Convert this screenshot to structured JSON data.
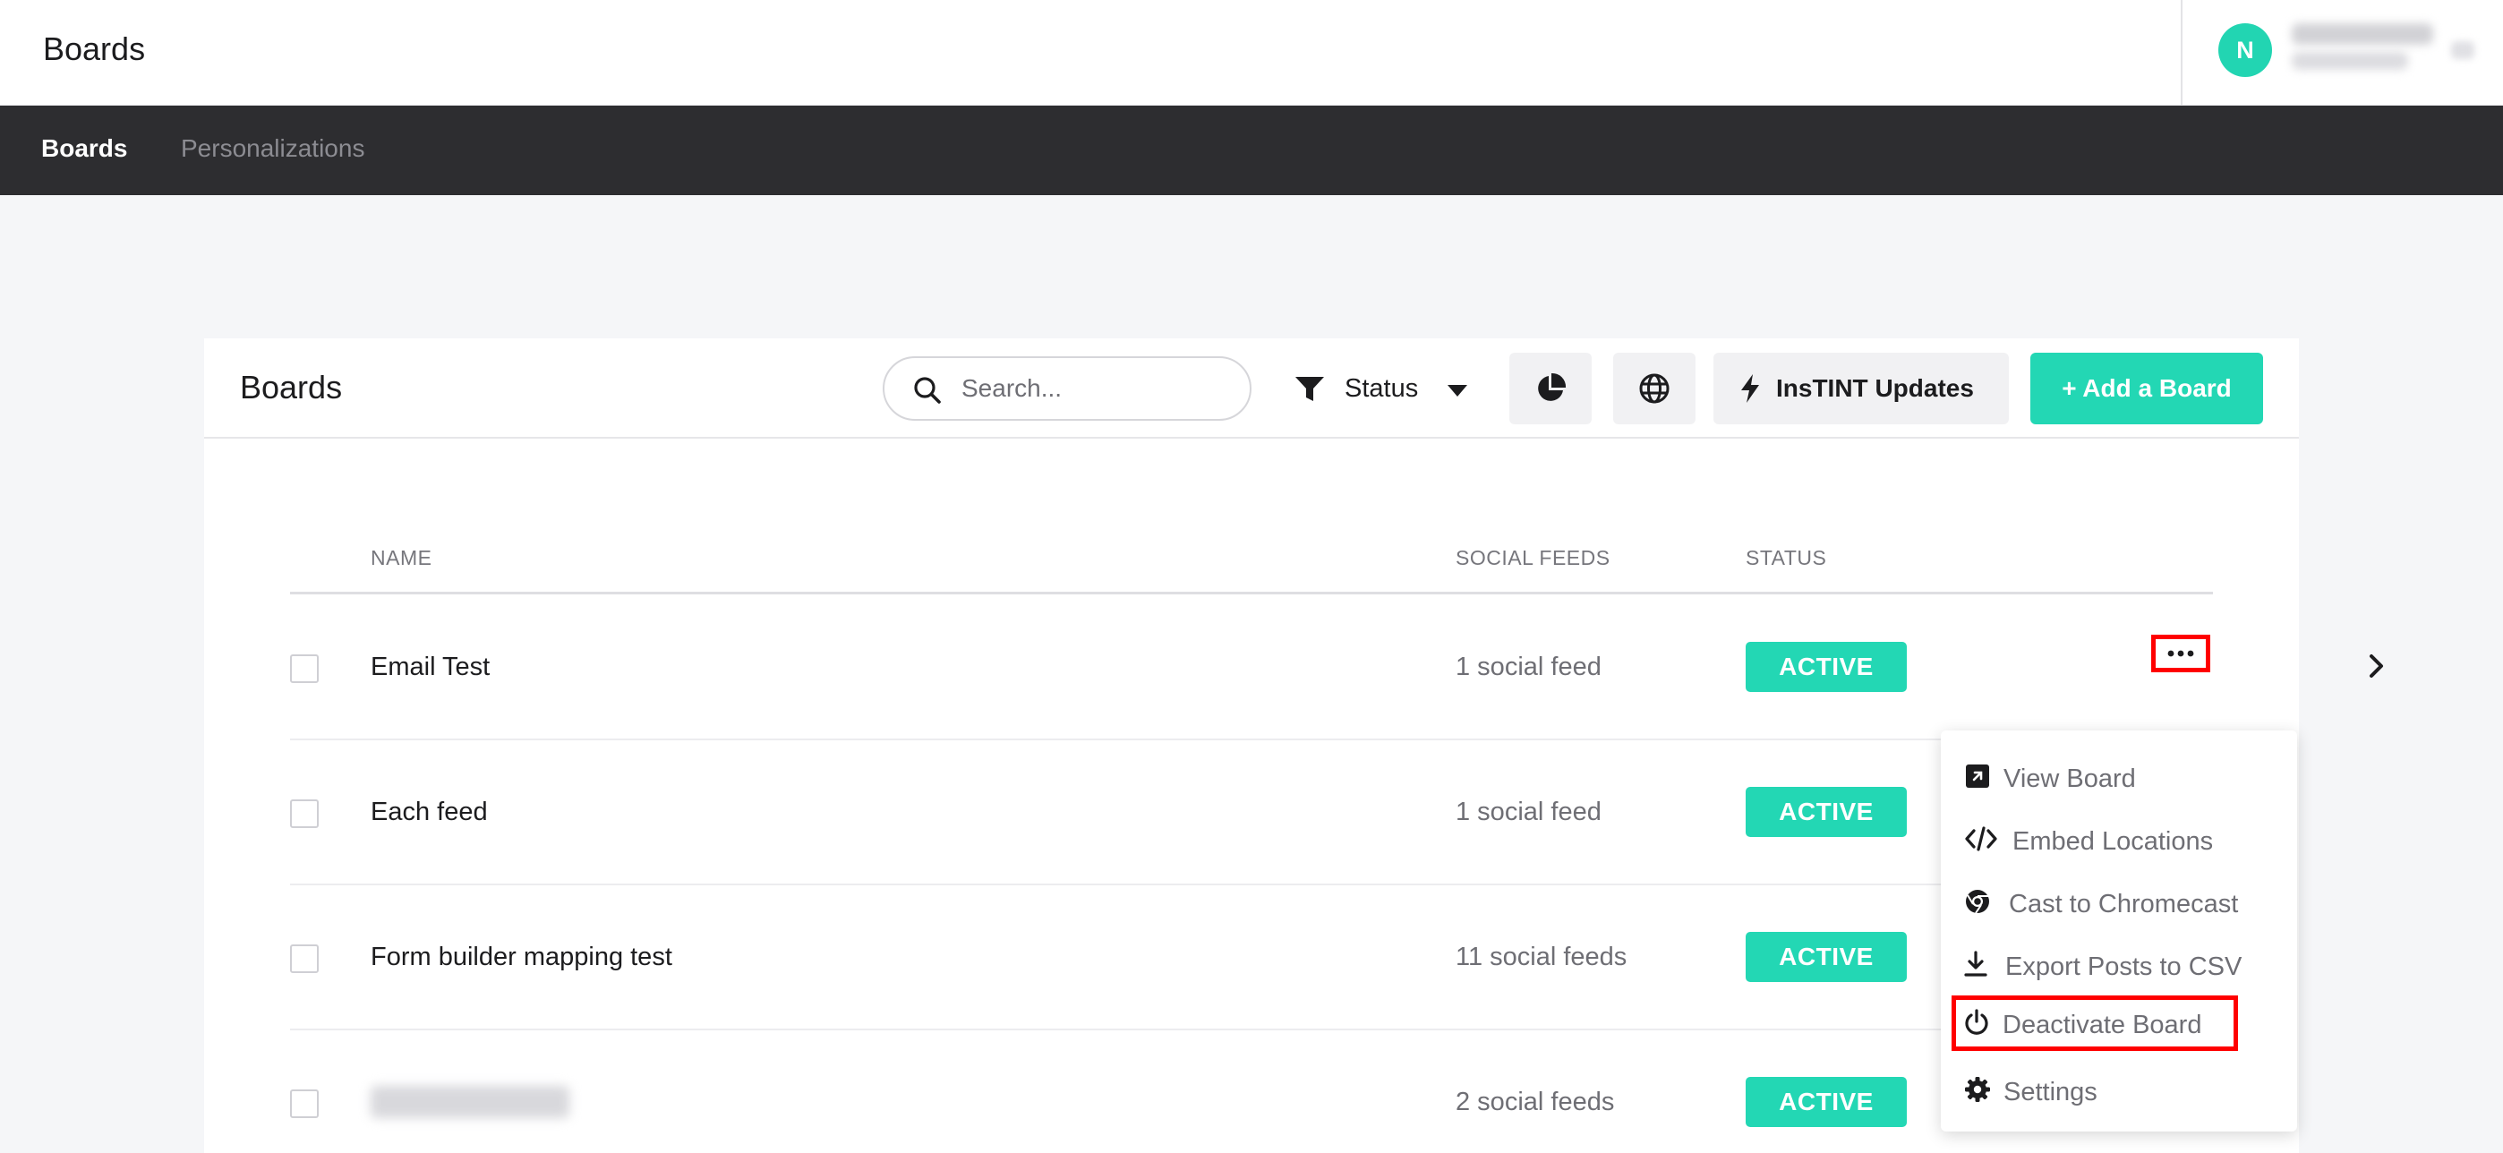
{
  "header": {
    "title": "Boards",
    "user": {
      "avatar_initial": "N"
    }
  },
  "nav": {
    "items": [
      {
        "label": "Boards",
        "active": true
      },
      {
        "label": "Personalizations",
        "active": false
      }
    ]
  },
  "card": {
    "title": "Boards",
    "search": {
      "placeholder": "Search...",
      "value": ""
    },
    "status_filter_label": "Status",
    "updates_button_label": "InsTINT Updates",
    "add_button_label": "+ Add a Board"
  },
  "table": {
    "headers": {
      "name": "NAME",
      "feeds": "SOCIAL FEEDS",
      "status": "STATUS"
    },
    "rows": [
      {
        "name": "Email Test",
        "feeds": "1 social feed",
        "status": "ACTIVE"
      },
      {
        "name": "Each feed",
        "feeds": "1 social feed",
        "status": "ACTIVE"
      },
      {
        "name": "Form builder mapping test",
        "feeds": "11 social feeds",
        "status": "ACTIVE"
      },
      {
        "name": "",
        "feeds": "2 social feeds",
        "status": "ACTIVE"
      }
    ]
  },
  "menu": {
    "items": [
      {
        "label": "View Board",
        "icon": "external-link-icon"
      },
      {
        "label": "Embed Locations",
        "icon": "code-icon"
      },
      {
        "label": "Cast to Chromecast",
        "icon": "chrome-icon"
      },
      {
        "label": "Export Posts to CSV",
        "icon": "download-icon"
      },
      {
        "label": "Deactivate Board",
        "icon": "power-icon"
      },
      {
        "label": "Settings",
        "icon": "gear-icon"
      }
    ]
  },
  "colors": {
    "accent": "#23d7b4",
    "nav_background": "#2d2d30",
    "highlight": "#ff0000"
  }
}
